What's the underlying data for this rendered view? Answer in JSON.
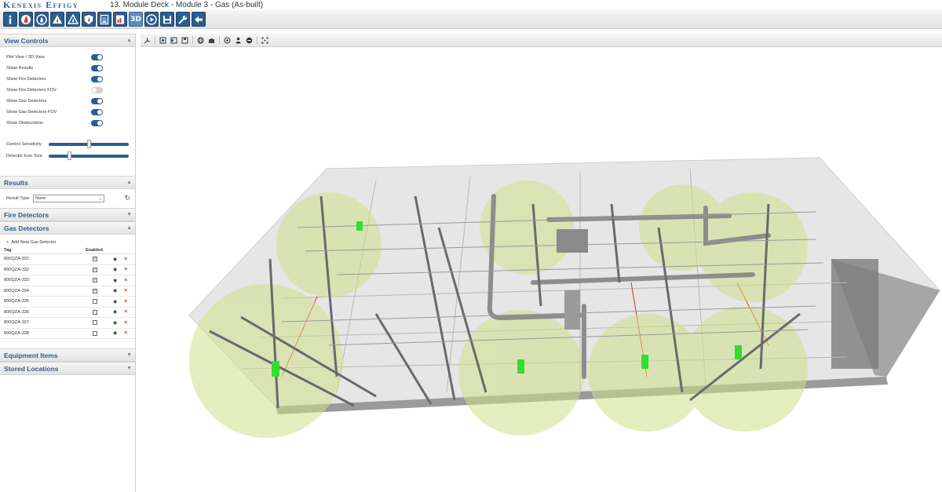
{
  "app": {
    "brand": "Kenexis Effigy",
    "doc_title": "13. Module Deck - Module 3 - Gas (As-built)"
  },
  "toolbar": {
    "buttons": [
      {
        "name": "info-button",
        "icon": "info-icon"
      },
      {
        "name": "fire-button",
        "icon": "fire-icon"
      },
      {
        "name": "flame-button",
        "icon": "flame-icon"
      },
      {
        "name": "warning-fire-button",
        "icon": "warning-fire-icon"
      },
      {
        "name": "fire-triangle-button",
        "icon": "fire-triangle-icon"
      },
      {
        "name": "shield-fire-button",
        "icon": "shield-fire-icon"
      },
      {
        "name": "document-button",
        "icon": "document-icon"
      },
      {
        "name": "report-button",
        "icon": "report-icon"
      },
      {
        "name": "3d-button",
        "icon": "3d-icon",
        "label": "3D"
      },
      {
        "name": "play-button",
        "icon": "play-icon"
      },
      {
        "name": "save-button",
        "icon": "save-icon"
      },
      {
        "name": "tools-button",
        "icon": "wrench-icon"
      },
      {
        "name": "back-button",
        "icon": "arrow-left-icon"
      }
    ]
  },
  "view_controls": {
    "title": "View Controls",
    "toggles": [
      {
        "label": "Plot View / 3D View",
        "on": true
      },
      {
        "label": "Show Results",
        "on": true
      },
      {
        "label": "Show Fire Detectors",
        "on": true
      },
      {
        "label": "Show Fire Detectors FOV",
        "on": false
      },
      {
        "label": "Show Gas Detectors",
        "on": true
      },
      {
        "label": "Show Gas Detectors FOV",
        "on": true
      },
      {
        "label": "Show Obstructions",
        "on": true
      }
    ],
    "sliders": [
      {
        "label": "Control Sensitivity",
        "level": 0.5
      },
      {
        "label": "Detector Icon Size",
        "level": 0.25
      }
    ]
  },
  "results": {
    "title": "Results",
    "result_type_label": "Result Type",
    "result_type_value": "None"
  },
  "fire_detectors": {
    "title": "Fire Detectors"
  },
  "gas_detectors": {
    "title": "Gas Detectors",
    "add_label": "Add New Gas Detector",
    "col_tag": "Tag",
    "col_enabled": "Enabled",
    "rows": [
      {
        "tag": "800QZA-331",
        "enabled": true
      },
      {
        "tag": "800QZA-332",
        "enabled": true
      },
      {
        "tag": "800QZA-333",
        "enabled": true
      },
      {
        "tag": "800QZA-334",
        "enabled": true
      },
      {
        "tag": "800QZA-335",
        "enabled": false
      },
      {
        "tag": "800QZA-336",
        "enabled": false
      },
      {
        "tag": "800QZA-337",
        "enabled": false
      },
      {
        "tag": "800QZA-338",
        "enabled": false
      }
    ]
  },
  "equipment_items": {
    "title": "Equipment Items"
  },
  "stored_locations": {
    "title": "Stored Locations"
  },
  "viewer_toolbar": {
    "icons": [
      "axes-icon",
      "view-front-icon",
      "view-side-icon",
      "view-top-icon",
      "globe-icon",
      "camera-icon",
      "target-icon",
      "person-icon",
      "minus-circle-icon",
      "fit-icon"
    ]
  },
  "colors": {
    "accent": "#2c5d8f",
    "fov": "#d6e6a4",
    "detector": "#33dd33",
    "cross": "#d9342b"
  }
}
